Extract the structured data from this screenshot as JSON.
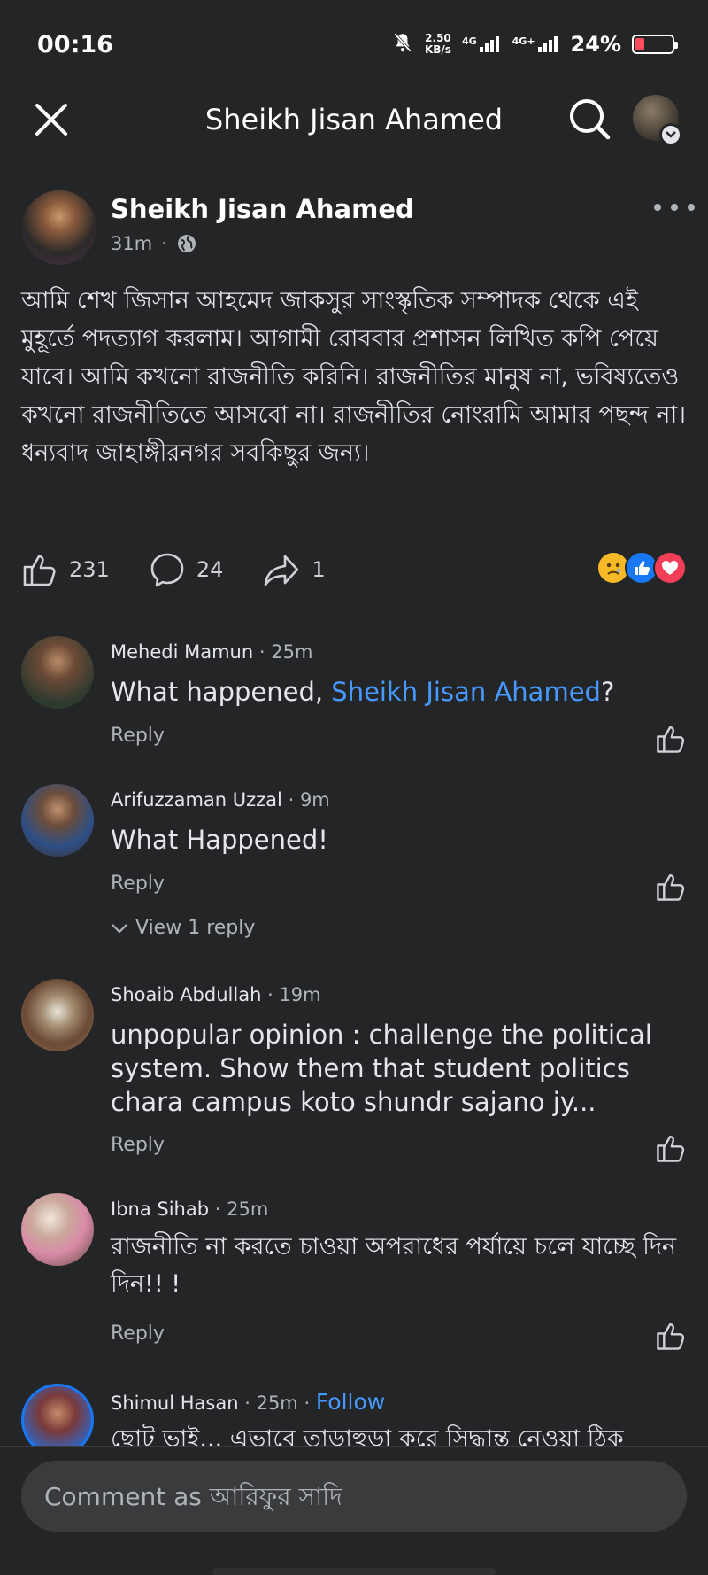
{
  "status_bar": {
    "time": "00:16",
    "net_speed_value": "2.50",
    "net_speed_unit": "KB/s",
    "signal1_label": "4G",
    "signal2_label": "4G+",
    "battery_pct": "24%"
  },
  "topbar": {
    "title": "Sheikh Jisan Ahamed"
  },
  "post": {
    "author": "Sheikh Jisan Ahamed",
    "time": "31m",
    "text": "আমি শেখ জিসান আহমেদ জাকসুর সাংস্কৃতিক সম্পাদক থেকে এই মুহূর্তে পদত্যাগ করলাম। আগামী রোববার প্রশাসন লিখিত কপি পেয়ে যাবে। আমি কখনো রাজনীতি করিনি। রাজনীতির মানুষ না, ভবিষ্যতেও কখনো রাজনীতিতে আসবো না। রাজনীতির নোংরামি আমার পছন্দ না। ধন্যবাদ জাহাঙ্গীরনগর সবকিছুর জন্য।",
    "likes": "231",
    "comments": "24",
    "shares": "1"
  },
  "comments": [
    {
      "name": "Mehedi Mamun",
      "time": "25m",
      "text_before": "What happened, ",
      "mention": "Sheikh Jisan Ahamed",
      "text_after": "?",
      "reply_label": "Reply"
    },
    {
      "name": "Arifuzzaman Uzzal",
      "time": "9m",
      "text": "What Happened!",
      "reply_label": "Reply",
      "view_replies": "View 1 reply"
    },
    {
      "name": "Shoaib Abdullah",
      "time": "19m",
      "text": "unpopular opinion : challenge the political system.  Show them that student politics chara campus koto shundr sajano jy...",
      "reply_label": "Reply"
    },
    {
      "name": "Ibna Sihab",
      "time": "25m",
      "text": "রাজনীতি না করতে চাওয়া অপরাধের পর্যায়ে চলে যাচ্ছে দিন দিন!! !",
      "reply_label": "Reply"
    },
    {
      "name": "Shimul Hasan",
      "time": "25m",
      "follow": "Follow",
      "text": "ছোট ভাই... এভাবে তাড়াহুড়া করে সিদ্ধান্ত নেওয়া ঠিক"
    }
  ],
  "composer": {
    "placeholder": "Comment as আরিফুর সাদি"
  },
  "colors": {
    "background": "#242526",
    "link": "#4599ff",
    "like_reaction": "#1877f2",
    "love_reaction": "#f33e58"
  }
}
